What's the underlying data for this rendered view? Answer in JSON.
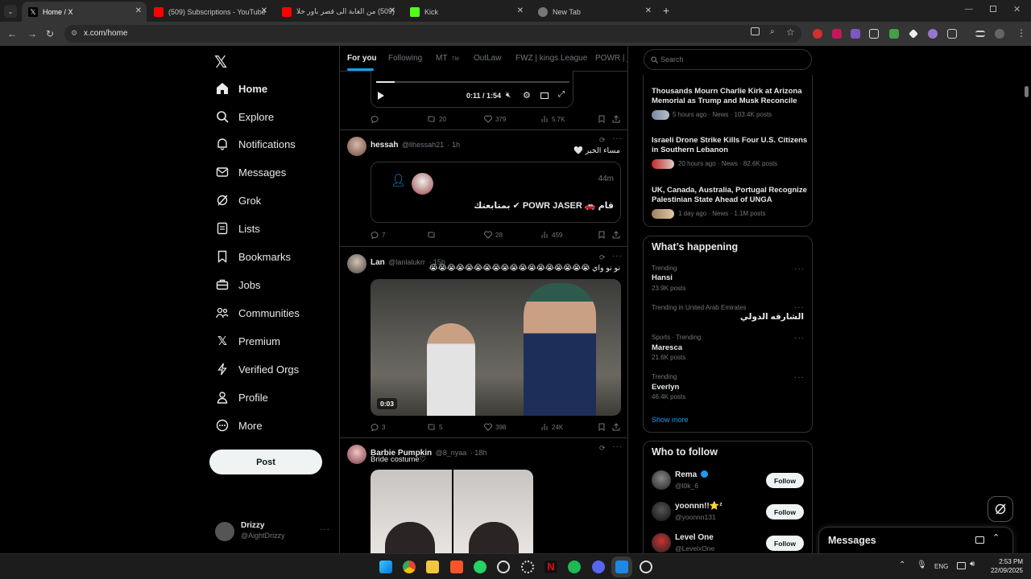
{
  "browser": {
    "tabs": [
      {
        "title": "Home / X",
        "active": true
      },
      {
        "title": "(509) Subscriptions - YouTube"
      },
      {
        "title": "(509) من الغابة الى قصر باور خلا"
      },
      {
        "title": "Kick"
      },
      {
        "title": "New Tab"
      }
    ],
    "new_tab_symbol": "+",
    "url": "x.com/home"
  },
  "nav": {
    "items": [
      {
        "label": "Home",
        "icon": "home-icon"
      },
      {
        "label": "Explore",
        "icon": "search-icon"
      },
      {
        "label": "Notifications",
        "icon": "bell-icon"
      },
      {
        "label": "Messages",
        "icon": "mail-icon"
      },
      {
        "label": "Grok",
        "icon": "grok-icon"
      },
      {
        "label": "Lists",
        "icon": "list-icon"
      },
      {
        "label": "Bookmarks",
        "icon": "bookmark-icon"
      },
      {
        "label": "Jobs",
        "icon": "briefcase-icon"
      },
      {
        "label": "Communities",
        "icon": "people-icon"
      },
      {
        "label": "Premium",
        "icon": "x-icon"
      },
      {
        "label": "Verified Orgs",
        "icon": "lightning-icon"
      },
      {
        "label": "Profile",
        "icon": "person-icon"
      },
      {
        "label": "More",
        "icon": "more-circle-icon"
      }
    ],
    "post_label": "Post",
    "account": {
      "name": "Drizzy",
      "handle": "@AightDrizzy"
    }
  },
  "feed": {
    "tabs": [
      "For you",
      "Following",
      "MT",
      "OutLaw",
      "FWZ | kings League",
      "POWR | ور"
    ],
    "mt_badge": "TM",
    "video_time": "0:11 / 1:54",
    "video_stats": {
      "replies": "",
      "reposts": "20",
      "likes": "379",
      "views": "5.7K"
    },
    "tweets": [
      {
        "name": "hessah",
        "handle": "@lihessah21",
        "time": "· 1h",
        "text": "مساء الخير 🤍",
        "quote": {
          "time": "44m",
          "text": "قام 🚗 POWR JASER ✔ بمتابعتك"
        },
        "stats": {
          "replies": "7",
          "reposts": "",
          "likes": "28",
          "views": "459"
        }
      },
      {
        "name": "Lan",
        "handle": "@lanlalukrr",
        "time": "· 15h",
        "text": "نو نو واي 😭😭😭😭😭😭😭😭😭😭😭😭😭😭😭😭😭😭",
        "video_duration": "0:03",
        "stats": {
          "replies": "3",
          "reposts": "5",
          "likes": "398",
          "views": "24K"
        }
      },
      {
        "name": "Barbie Pumpkin",
        "handle": "@8_nyaa",
        "time": "· 18h",
        "text": "Bride costume♡"
      }
    ]
  },
  "sidebar": {
    "search_placeholder": "Search",
    "news": [
      {
        "title": "Thousands Mourn Charlie Kirk at Arizona Memorial as Trump and Musk Reconcile",
        "meta": "5 hours ago · News · 103.4K posts"
      },
      {
        "title": "Israeli Drone Strike Kills Four U.S. Citizens in Southern Lebanon",
        "meta": "20 hours ago · News · 82.6K posts"
      },
      {
        "title": "UK, Canada, Australia, Portugal Recognize Palestinian State Ahead of UNGA",
        "meta": "1 day ago · News · 1.1M posts"
      }
    ],
    "happening": {
      "title": "What’s happening",
      "trends": [
        {
          "context": "Trending",
          "name": "Hansi",
          "count": "23.9K posts"
        },
        {
          "context": "Trending in United Arab Emirates",
          "name": "الشارقه الدولي",
          "count": ""
        },
        {
          "context": "Sports · Trending",
          "name": "Maresca",
          "count": "21.6K posts"
        },
        {
          "context": "Trending",
          "name": "Everlyn",
          "count": "46.4K posts"
        }
      ],
      "show_more": "Show more"
    },
    "who_to_follow": {
      "title": "Who to follow",
      "users": [
        {
          "name": "Rema",
          "handle": "@l0k_6"
        },
        {
          "name": "yoonnn!!⭐²",
          "handle": "@yoonnn131"
        },
        {
          "name": "Level One",
          "handle": "@LevelxOne"
        }
      ],
      "follow_label": "Follow"
    },
    "messages_label": "Messages"
  },
  "taskbar": {
    "lang": "ENG",
    "time": "2:53 PM",
    "date": "22/09/2025"
  },
  "colors": {
    "accent": "#1d9bf0",
    "bg": "#000000",
    "border": "#2f3336",
    "muted": "#71767b"
  }
}
